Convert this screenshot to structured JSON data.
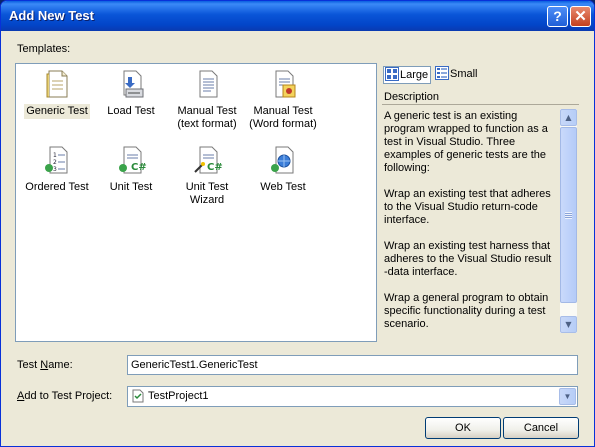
{
  "window": {
    "title": "Add New Test",
    "help_glyph": "?",
    "close_glyph": "✕"
  },
  "templates_label": "Templates:",
  "templates": [
    {
      "label": "Generic Test",
      "icon": "generic-test-icon",
      "selected": true
    },
    {
      "label": "Load Test",
      "icon": "load-test-icon"
    },
    {
      "label": "Manual Test\n(text format)",
      "icon": "manual-test-text-icon"
    },
    {
      "label": "Manual Test\n(Word format)",
      "icon": "manual-test-word-icon"
    },
    {
      "label": "Ordered Test",
      "icon": "ordered-test-icon"
    },
    {
      "label": "Unit Test",
      "icon": "unit-test-icon"
    },
    {
      "label": "Unit Test\nWizard",
      "icon": "unit-test-wizard-icon"
    },
    {
      "label": "Web Test",
      "icon": "web-test-icon"
    }
  ],
  "view_toggle": {
    "large_label": "Large",
    "small_label": "Small",
    "selected": "Large"
  },
  "description": {
    "header": "Description",
    "paragraphs": [
      "A generic test is an existing program wrapped to function as a test in Visual Studio. Three examples of generic tests are the following:",
      "Wrap an existing test that adheres to the Visual Studio return-code interface.",
      "Wrap an existing test harness that adheres to the Visual Studio result -data interface.",
      "Wrap a general program to obtain specific functionality during a test scenario."
    ]
  },
  "test_name": {
    "label_pre": "Test ",
    "label_underlined": "N",
    "label_post": "ame:",
    "value": "GenericTest1.GenericTest"
  },
  "add_to_project": {
    "label_underlined": "A",
    "label_post": "dd to Test Project:",
    "value": "TestProject1"
  },
  "buttons": {
    "ok": "OK",
    "cancel": "Cancel"
  },
  "colors": {
    "title_bar": "#0a55d8",
    "dialog_face": "#ece9d8",
    "field_border": "#7f9db9"
  }
}
